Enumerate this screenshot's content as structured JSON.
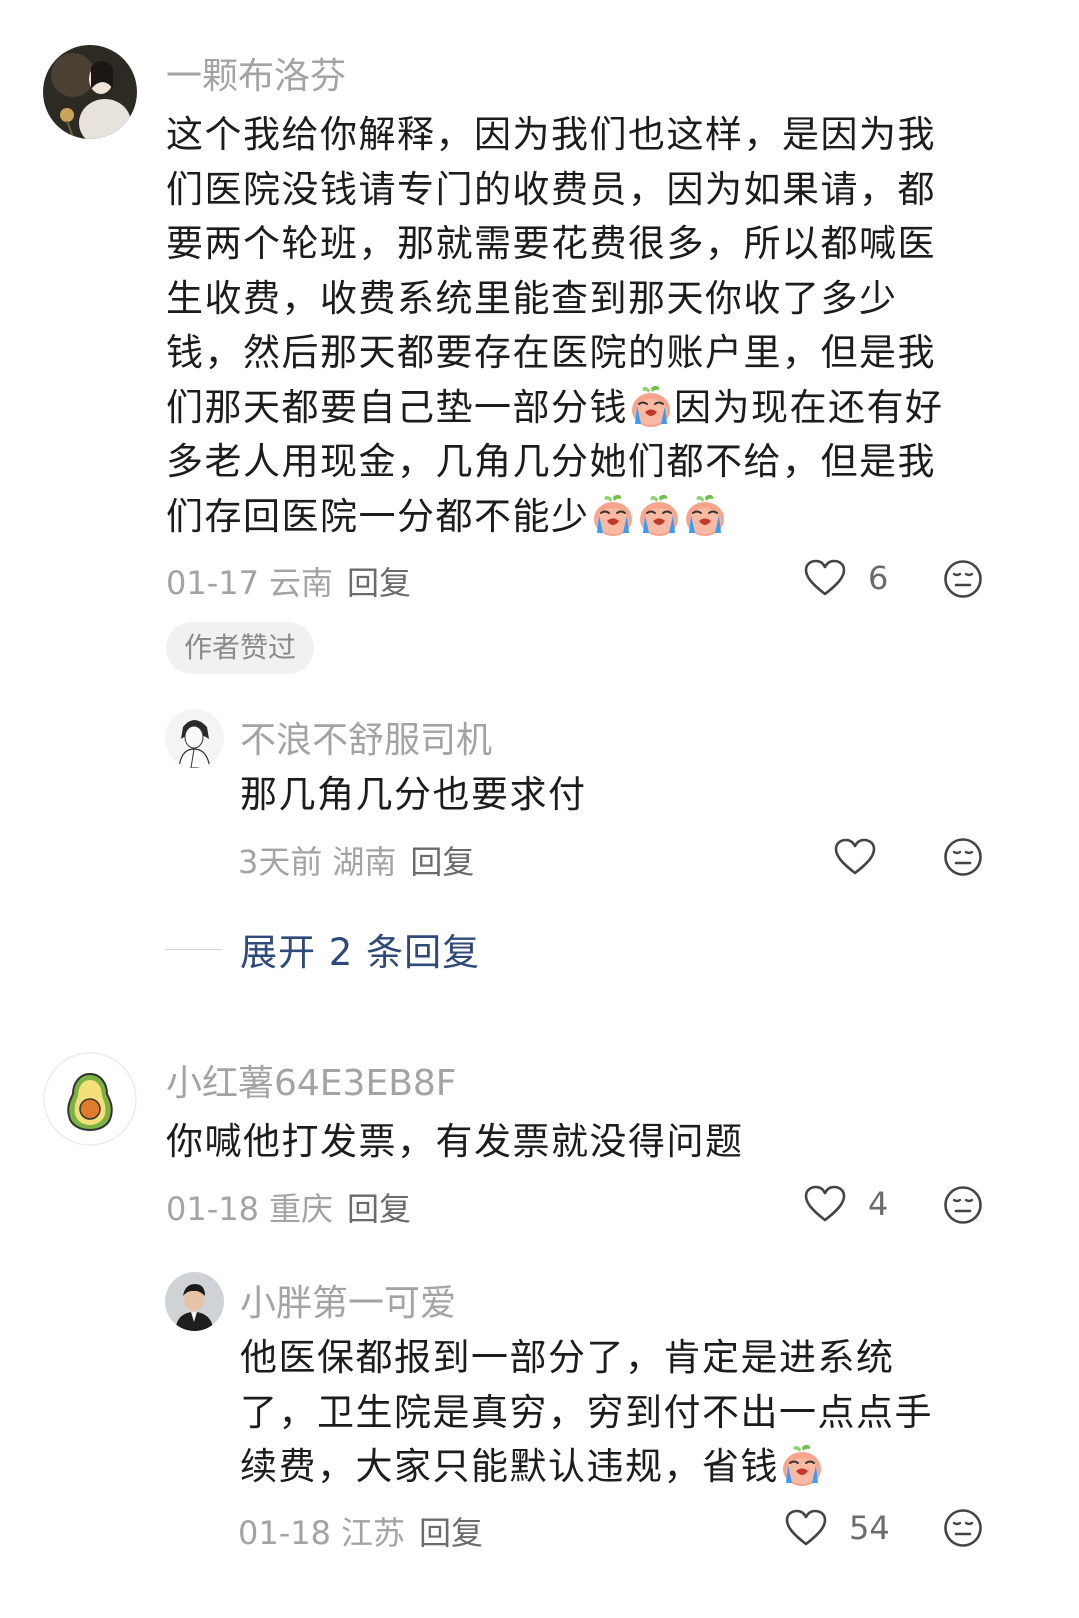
{
  "comments": [
    {
      "username": "一颗布洛芬",
      "body_lines": [
        "这个我给你解释，因为我们也这样，是因为我",
        "们医院没钱请专门的收费员，因为如果请，都",
        "要两个轮班，那就需要花费很多，所以都喊医",
        "生收费，收费系统里能查到那天你收了多少",
        "钱，然后那天都要存在医院的账户里，但是我"
      ],
      "body_line6_a": "们那天都要自己垫一部分钱",
      "body_line6_b": "因为现在还有好",
      "body_line7": "多老人用现金，几角几分她们都不给，但是我",
      "body_line8": "们存回医院一分都不能少",
      "date": "01-17",
      "location": "云南",
      "reply_label": "回复",
      "likes": "6",
      "badge": "作者赞过",
      "replies": [
        {
          "username": "不浪不舒服司机",
          "body": "那几角几分也要求付",
          "date": "3天前",
          "location": "湖南",
          "reply_label": "回复",
          "likes": ""
        }
      ],
      "expand_label": "展开 2 条回复"
    },
    {
      "username": "小红薯64E3EB8F",
      "body": "你喊他打发票，有发票就没得问题",
      "date": "01-18",
      "location": "重庆",
      "reply_label": "回复",
      "likes": "4",
      "replies": [
        {
          "username": "小胖第一可爱",
          "body_lines": [
            "他医保都报到一部分了，肯定是进系统",
            "了，卫生院是真穷，穷到付不出一点点手"
          ],
          "body_line3": "续费，大家只能默认违规，省钱",
          "date": "01-18",
          "location": "江苏",
          "reply_label": "回复",
          "likes": "54"
        }
      ]
    }
  ],
  "icons": {
    "like": "heart-outline-icon",
    "dislike": "meh-face-icon",
    "emoji": "crying-peach-emoji"
  },
  "colors": {
    "meta": "#a3a3a3",
    "body": "#1c1c1c",
    "expand": "#2f4a7a",
    "badge_bg": "#f1f1f1"
  }
}
